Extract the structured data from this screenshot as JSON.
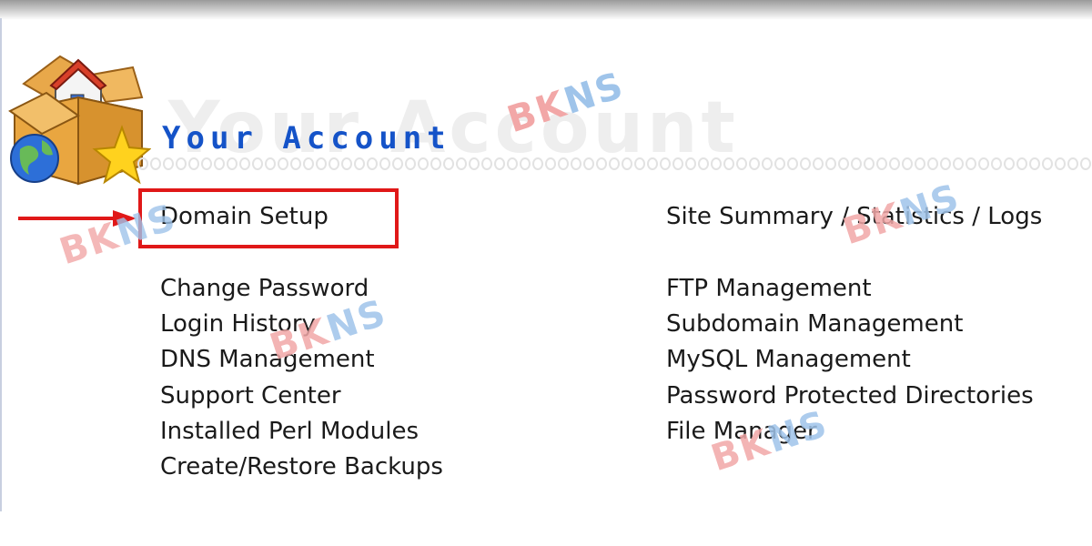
{
  "header": {
    "title": "Your Account",
    "ghost_title": "Your Account"
  },
  "links": {
    "left": [
      "Domain Setup",
      "Change Password",
      "Login History",
      "DNS Management",
      "Support Center",
      "Installed Perl Modules",
      "Create/Restore Backups"
    ],
    "right": [
      "Site Summary / Statistics / Logs",
      "FTP Management",
      "Subdomain Management",
      "MySQL Management",
      "Password Protected Directories",
      "File Manager"
    ]
  },
  "annotation": {
    "highlight_color": "#e01818",
    "arrow_color": "#e01818"
  },
  "watermark": {
    "text_left": "BK",
    "text_right": "NS",
    "color_left": "#f2a7a7",
    "color_right": "#9fc4ea"
  },
  "colors": {
    "title": "#1553c8"
  },
  "icons": {
    "logo": "house-box-globe-star-icon"
  }
}
